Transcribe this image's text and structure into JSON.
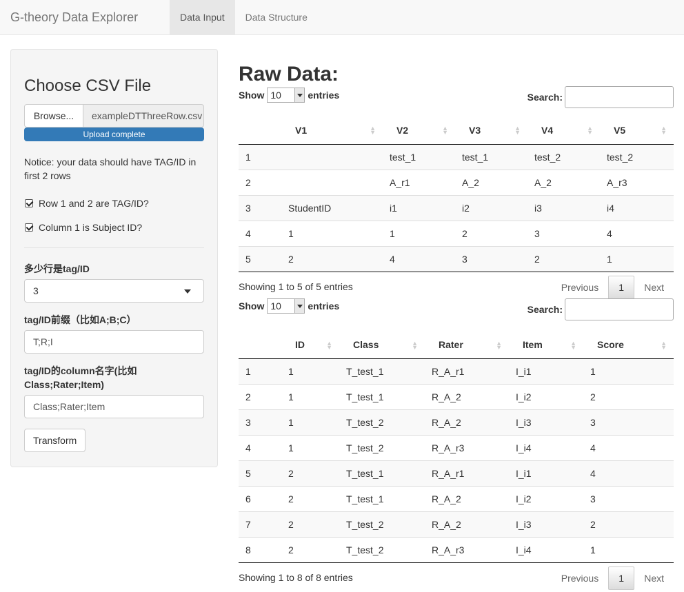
{
  "navbar": {
    "brand": "G-theory Data Explorer",
    "tabs": [
      {
        "label": "Data Input"
      },
      {
        "label": "Data Structure"
      }
    ]
  },
  "sidebar": {
    "title": "Choose CSV File",
    "browse_label": "Browse...",
    "file_name": "exampleDTThreeRow.csv",
    "upload_status": "Upload complete",
    "notice": "Notice: your data should have TAG/ID in first 2 rows",
    "checkbox1": "Row 1 and 2 are TAG/ID?",
    "checkbox2": "Column 1 is Subject ID?",
    "rows_label": "多少行是tag/ID",
    "rows_value": "3",
    "prefix_label": "tag/ID前缀（比如A;B;C）",
    "prefix_value": "T;R;I",
    "colnames_label": "tag/ID的column名字(比如Class;Rater;Item)",
    "colnames_value": "Class;Rater;Item",
    "transform_label": "Transform"
  },
  "main": {
    "title": "Raw Data:",
    "show_label": "Show",
    "entries_label": "entries",
    "length_value": "10",
    "search_label": "Search:",
    "prev_label": "Previous",
    "next_label": "Next",
    "page": "1",
    "table1": {
      "headers": [
        "",
        "V1",
        "V2",
        "V3",
        "V4",
        "V5"
      ],
      "rows": [
        [
          "1",
          "",
          "test_1",
          "test_1",
          "test_2",
          "test_2"
        ],
        [
          "2",
          "",
          "A_r1",
          "A_2",
          "A_2",
          "A_r3"
        ],
        [
          "3",
          "StudentID",
          "i1",
          "i2",
          "i3",
          "i4"
        ],
        [
          "4",
          "1",
          "1",
          "2",
          "3",
          "4"
        ],
        [
          "5",
          "2",
          "4",
          "3",
          "2",
          "1"
        ]
      ],
      "info": "Showing 1 to 5 of 5 entries"
    },
    "table2": {
      "headers": [
        "",
        "ID",
        "Class",
        "Rater",
        "Item",
        "Score"
      ],
      "rows": [
        [
          "1",
          "1",
          "T_test_1",
          "R_A_r1",
          "I_i1",
          "1"
        ],
        [
          "2",
          "1",
          "T_test_1",
          "R_A_2",
          "I_i2",
          "2"
        ],
        [
          "3",
          "1",
          "T_test_2",
          "R_A_2",
          "I_i3",
          "3"
        ],
        [
          "4",
          "1",
          "T_test_2",
          "R_A_r3",
          "I_i4",
          "4"
        ],
        [
          "5",
          "2",
          "T_test_1",
          "R_A_r1",
          "I_i1",
          "4"
        ],
        [
          "6",
          "2",
          "T_test_1",
          "R_A_2",
          "I_i2",
          "3"
        ],
        [
          "7",
          "2",
          "T_test_2",
          "R_A_2",
          "I_i3",
          "2"
        ],
        [
          "8",
          "2",
          "T_test_2",
          "R_A_r3",
          "I_i4",
          "1"
        ]
      ],
      "info": "Showing 1 to 8 of 8 entries"
    }
  }
}
